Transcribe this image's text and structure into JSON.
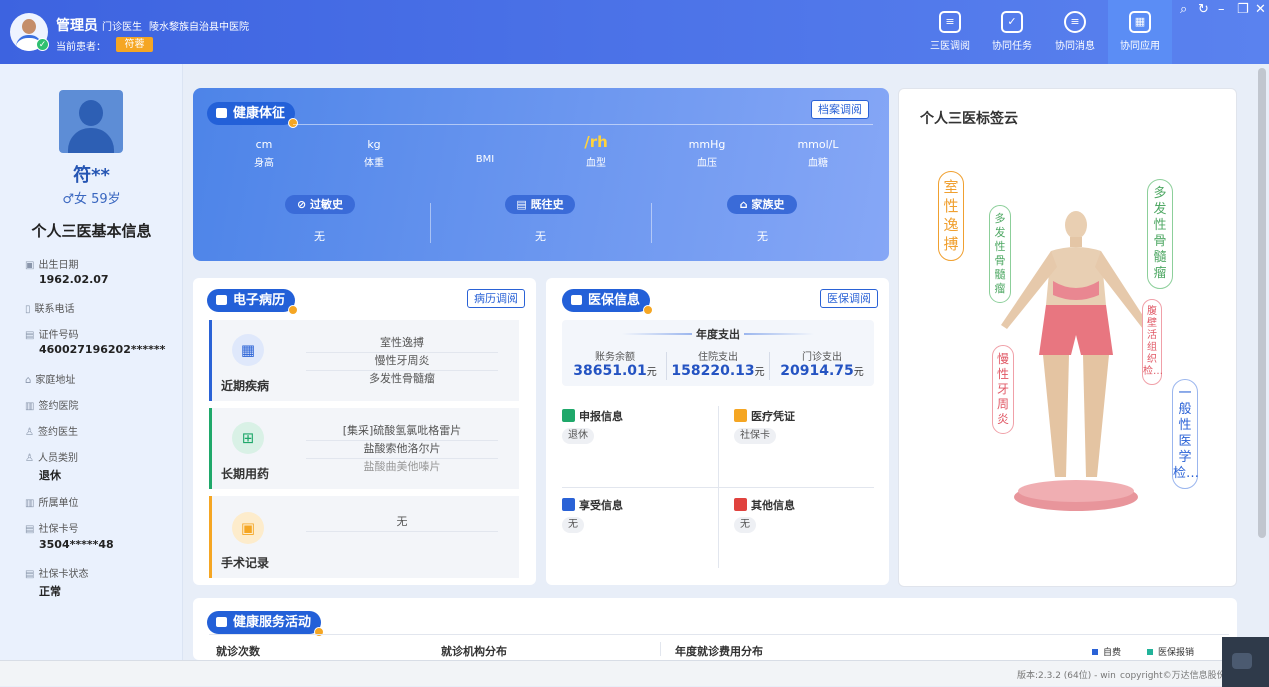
{
  "header": {
    "user_name": "管理员",
    "user_role": "门诊医生",
    "hospital": "陵水黎族自治县中医院",
    "current_patient_label": "当前患者：",
    "current_patient": "符蓉",
    "nav": [
      {
        "label": "三医调阅",
        "icon": "document-icon"
      },
      {
        "label": "协同任务",
        "icon": "task-check-icon"
      },
      {
        "label": "协同消息",
        "icon": "message-icon"
      },
      {
        "label": "协同应用",
        "icon": "apps-grid-icon",
        "active": true
      }
    ]
  },
  "sidebar": {
    "name": "符**",
    "gender_age": "♂女  59岁",
    "title": "个人三医基本信息",
    "fields": [
      {
        "label": "出生日期",
        "value": "1962.02.07"
      },
      {
        "label": "联系电话",
        "value": ""
      },
      {
        "label": "证件号码",
        "value": "460027196202******"
      },
      {
        "label": "家庭地址",
        "value": ""
      },
      {
        "label": "签约医院",
        "value": ""
      },
      {
        "label": "签约医生",
        "value": ""
      },
      {
        "label": "人员类别",
        "value": "退休"
      },
      {
        "label": "所属单位",
        "value": ""
      },
      {
        "label": "社保卡号",
        "value": "3504*****48"
      },
      {
        "label": "社保卡状态",
        "value": "正常"
      }
    ]
  },
  "health": {
    "title": "健康体征",
    "archive_button": "档案调阅",
    "vitals": [
      {
        "unit": "cm",
        "label": "身高"
      },
      {
        "unit": "kg",
        "label": "体重"
      },
      {
        "unit": "",
        "label": "BMI"
      },
      {
        "unit": "/rh",
        "label": "血型"
      },
      {
        "unit": "mmHg",
        "label": "血压"
      },
      {
        "unit": "mmol/L",
        "label": "血糖"
      }
    ],
    "histories": [
      {
        "label": "过敏史",
        "value": "无"
      },
      {
        "label": "既往史",
        "value": "无"
      },
      {
        "label": "家族史",
        "value": "无"
      }
    ]
  },
  "emr": {
    "title": "电子病历",
    "button": "病历调阅",
    "sections": [
      {
        "label": "近期疾病",
        "items": [
          "室性逸搏",
          "慢性牙周炎",
          "多发性骨髓瘤"
        ]
      },
      {
        "label": "长期用药",
        "items": [
          "[集采]硫酸氢氯吡格雷片",
          "盐酸索他洛尔片",
          "盐酸曲美他嗪片"
        ]
      },
      {
        "label": "手术记录",
        "items": [
          "无"
        ]
      }
    ]
  },
  "insurance": {
    "title": "医保信息",
    "button": "医保调阅",
    "annual_title": "年度支出",
    "stats": [
      {
        "label": "账务余额",
        "value": "38651.01",
        "unit": "元"
      },
      {
        "label": "住院支出",
        "value": "158220.13",
        "unit": "元"
      },
      {
        "label": "门诊支出",
        "value": "20914.75",
        "unit": "元"
      }
    ],
    "blocks": [
      {
        "title": "申报信息",
        "value": "退休",
        "color": "#1fa86a"
      },
      {
        "title": "医疗凭证",
        "value": "社保卡",
        "color": "#f5a623"
      },
      {
        "title": "享受信息",
        "value": "无",
        "color": "#2a62d6"
      },
      {
        "title": "其他信息",
        "value": "无",
        "color": "#e0423e"
      }
    ]
  },
  "cloud": {
    "title": "个人三医标签云",
    "tags": [
      "室性逸搏",
      "多发性骨髓瘤",
      "多发性骨髓瘤",
      "腹壁活组织检…",
      "慢性牙周炎",
      "一般性医学检…"
    ]
  },
  "activity": {
    "title": "健康服务活动",
    "col1": "就诊次数",
    "col2": "就诊机构分布",
    "col3": "年度就诊费用分布",
    "legend": [
      {
        "label": "自费",
        "color": "#2a62d6"
      },
      {
        "label": "医保报销",
        "color": "#22b39a"
      }
    ]
  },
  "footer": {
    "version": "版本:2.3.2 (64位) - win",
    "copyright": "copyright©万达信息股份"
  }
}
